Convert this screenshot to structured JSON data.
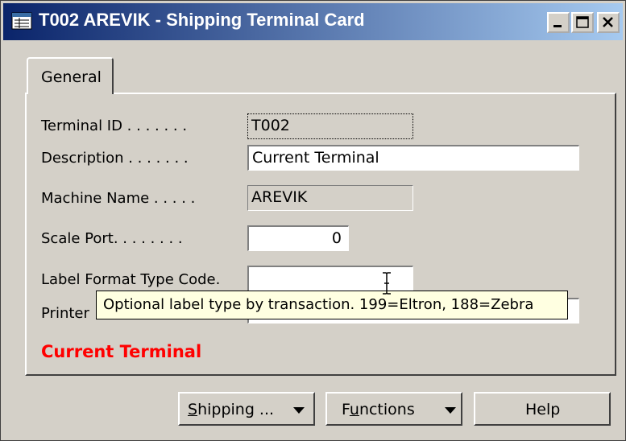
{
  "window": {
    "title": "T002 AREVIK - Shipping Terminal Card",
    "icon": "card-icon",
    "controls": [
      "minimize-icon",
      "maximize-icon",
      "close-icon"
    ]
  },
  "tabs": [
    {
      "label": "General",
      "selected": true
    }
  ],
  "fields": {
    "terminal_id": {
      "label": "Terminal ID . . . . . . .",
      "value": "T002"
    },
    "description": {
      "label": "Description . . . . . . .",
      "value": "Current Terminal"
    },
    "machine_name": {
      "label": "Machine Name . . . . .",
      "value": "AREVIK"
    },
    "scale_port": {
      "label": "Scale Port. . . . . . . .",
      "value": "0"
    },
    "label_format_type_code": {
      "label": "Label Format Type Code.",
      "value": ""
    },
    "printer": {
      "label": "Printer",
      "value": ""
    }
  },
  "tooltip": "Optional label type by transaction.  199=Eltron, 188=Zebra",
  "status_text": "Current Terminal",
  "status_color": "#ff0000",
  "buttons": {
    "shipping_first": "S",
    "shipping_rest": "hipping ...",
    "functions_first": "F",
    "functions_u": "u",
    "functions_rest": "nctions",
    "help": "Help"
  }
}
